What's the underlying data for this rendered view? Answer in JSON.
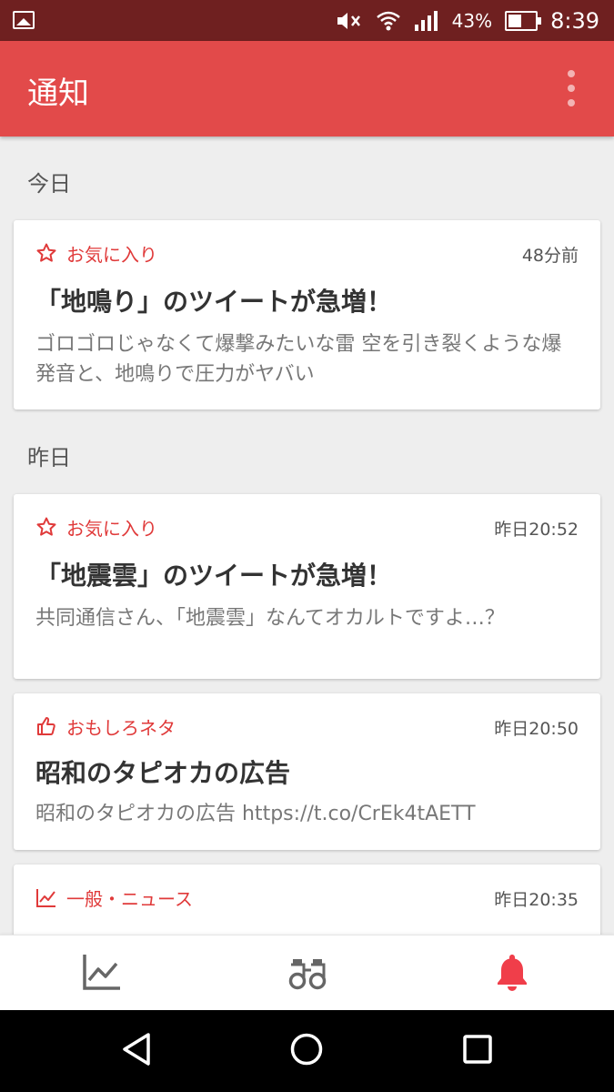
{
  "status_bar": {
    "battery": "43%",
    "battery_level": 0.43,
    "time": "8:39"
  },
  "app_bar": {
    "title": "通知"
  },
  "sections": {
    "today": "今日",
    "yesterday": "昨日"
  },
  "cards": [
    {
      "category": "お気に入り",
      "icon": "star-icon",
      "time": "48分前",
      "title": "「地鳴り」のツイートが急増！",
      "body": "ゴロゴロじゃなくて爆撃みたいな雷 空を引き裂くような爆発音と、地鳴りで圧力がヤバい"
    },
    {
      "category": "お気に入り",
      "icon": "star-icon",
      "time": "昨日20:52",
      "title": "「地震雲」のツイートが急増！",
      "body": "共同通信さん、「地震雲」なんてオカルトですよ…？"
    },
    {
      "category": "おもしろネタ",
      "icon": "thumbs-up-icon",
      "time": "昨日20:50",
      "title": "昭和のタピオカの広告",
      "body": "昭和のタピオカの広告 https://t.co/CrEk4tAETT"
    },
    {
      "category": "一般・ニュース",
      "icon": "trending-icon",
      "time": "昨日20:35",
      "title": "",
      "body": ""
    }
  ],
  "bottom_nav": {
    "items": [
      {
        "icon": "trend-chart-icon",
        "active": false
      },
      {
        "icon": "binoculars-icon",
        "active": false
      },
      {
        "icon": "bell-icon",
        "active": true
      }
    ]
  },
  "colors": {
    "status_bar": "#6f2020",
    "app_bar": "#e24a4a",
    "accent": "#e03a3a"
  }
}
